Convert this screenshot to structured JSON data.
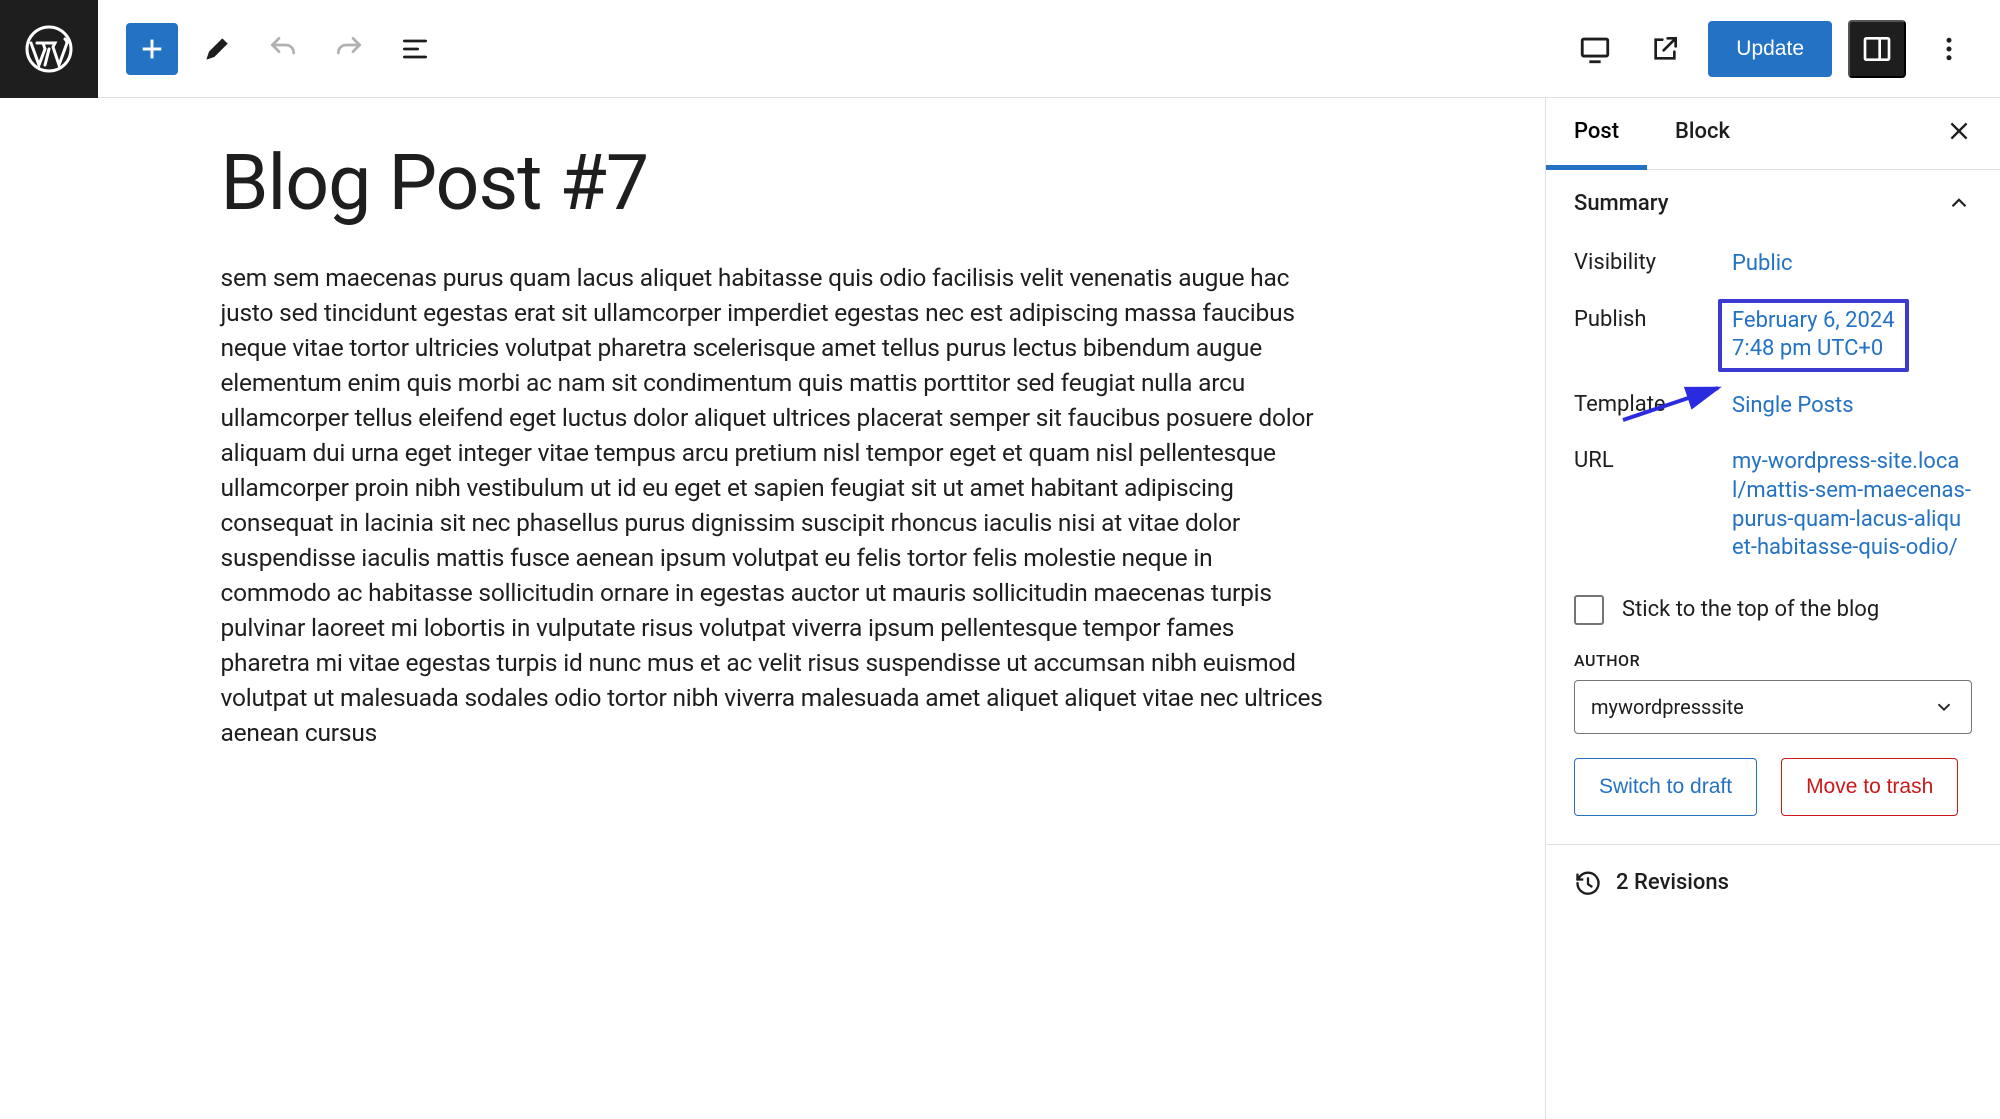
{
  "toolbar": {
    "update_label": "Update"
  },
  "editor": {
    "title": "Blog Post #7",
    "body": "sem sem maecenas purus quam lacus aliquet habitasse quis odio facilisis velit venenatis augue hac justo sed tincidunt egestas erat sit ullamcorper imperdiet egestas nec est adipiscing massa faucibus neque vitae tortor ultricies volutpat pharetra scelerisque amet tellus purus lectus bibendum augue elementum enim quis morbi ac nam sit condimentum quis mattis porttitor sed feugiat nulla arcu ullamcorper tellus eleifend eget luctus dolor aliquet ultrices placerat semper sit faucibus posuere dolor aliquam dui urna eget integer vitae tempus arcu pretium nisl tempor eget et quam nisl pellentesque ullamcorper proin nibh vestibulum ut id eu eget et sapien feugiat sit ut amet habitant adipiscing consequat in lacinia sit nec phasellus purus dignissim suscipit rhoncus iaculis nisi at vitae dolor suspendisse iaculis mattis fusce aenean ipsum volutpat eu felis tortor felis molestie neque in commodo ac habitasse sollicitudin ornare in egestas auctor ut mauris sollicitudin maecenas turpis pulvinar laoreet mi lobortis in vulputate risus volutpat viverra ipsum pellentesque tempor fames pharetra mi vitae egestas turpis id nunc mus et ac velit risus suspendisse ut accumsan nibh euismod volutpat ut malesuada sodales odio tortor nibh viverra malesuada amet aliquet aliquet vitae nec ultrices aenean cursus"
  },
  "sidebar": {
    "tabs": {
      "post": "Post",
      "block": "Block"
    },
    "summary": {
      "heading": "Summary",
      "visibility_label": "Visibility",
      "visibility_value": "Public",
      "publish_label": "Publish",
      "publish_value_line1": "February 6, 2024",
      "publish_value_line2": "7:48 pm UTC+0",
      "template_label": "Template",
      "template_value": "Single Posts",
      "url_label": "URL",
      "url_value": "my-wordpress-site.local/mattis-sem-maecenas-purus-quam-lacus-aliquet-habitasse-quis-odio/",
      "sticky_label": "Stick to the top of the blog",
      "author_heading": "AUTHOR",
      "author_value": "mywordpresssite",
      "switch_draft": "Switch to draft",
      "move_trash": "Move to trash"
    },
    "revisions": "2 Revisions"
  }
}
